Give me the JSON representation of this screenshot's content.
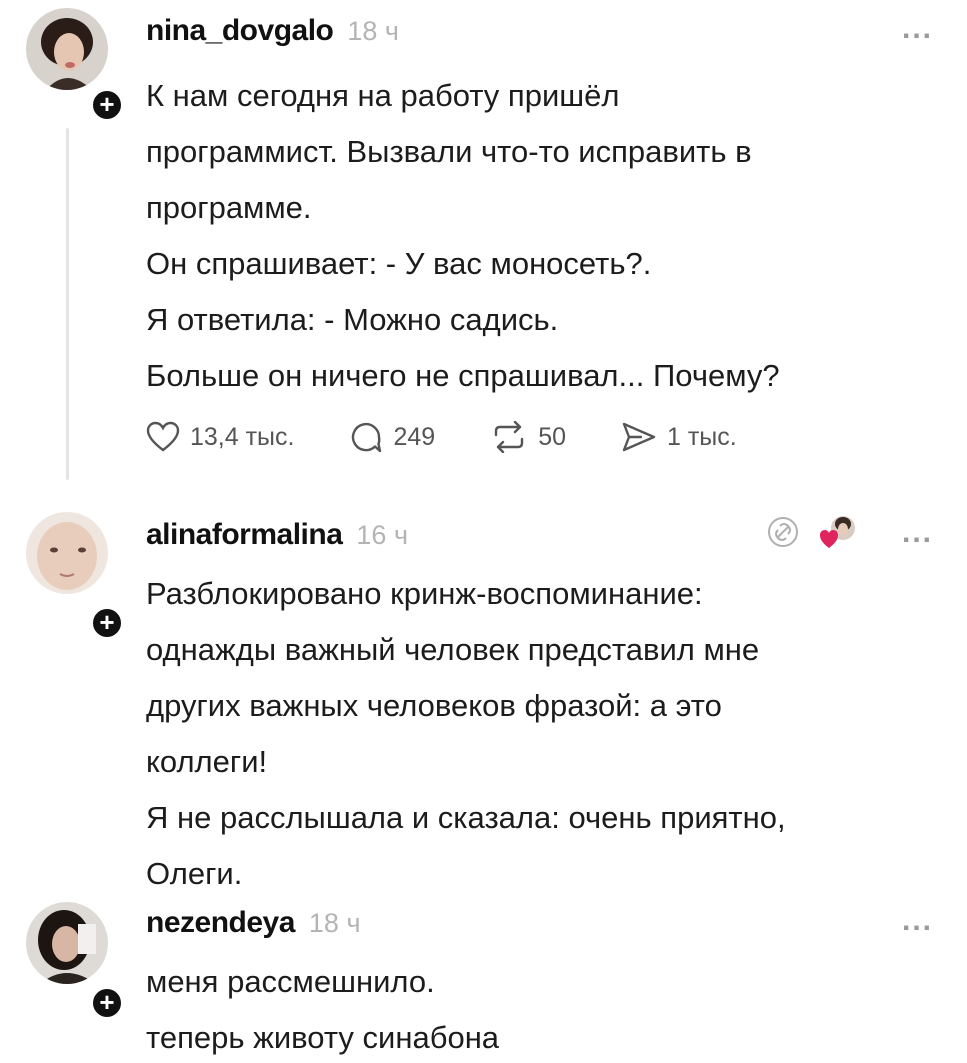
{
  "posts": [
    {
      "username": "nina_dovgalo",
      "time": "18 ч",
      "more_label": "...",
      "lines": [
        "К нам сегодня на работу пришёл",
        "программист. Вызвали что-то исправить в",
        "программе.",
        "Он спрашивает: - У вас моносеть?.",
        "Я ответила: - Можно садись.",
        "Больше он ничего не спрашивал... Почему?"
      ],
      "actions": {
        "likes": "13,4 тыс.",
        "comments": "249",
        "reposts": "50",
        "shares": "1 тыс."
      }
    },
    {
      "username": "alinaformalina",
      "time": "16 ч",
      "more_label": "...",
      "lines": [
        "Разблокировано кринж-воспоминание:",
        "однажды важный человек представил мне",
        "других важных человеков фразой: а это",
        "коллеги!",
        "Я не расслышала и сказала: очень приятно,",
        "Олеги."
      ]
    },
    {
      "username": "nezendeya",
      "time": "18 ч",
      "more_label": "...",
      "lines": [
        "меня рассмешнило.",
        "теперь животу синабона"
      ]
    }
  ],
  "follow_badge": "+",
  "colors": {
    "text": "#1c1c1c",
    "muted": "#b4b4b4",
    "badge": "#111111",
    "heart": "#e0245e"
  }
}
